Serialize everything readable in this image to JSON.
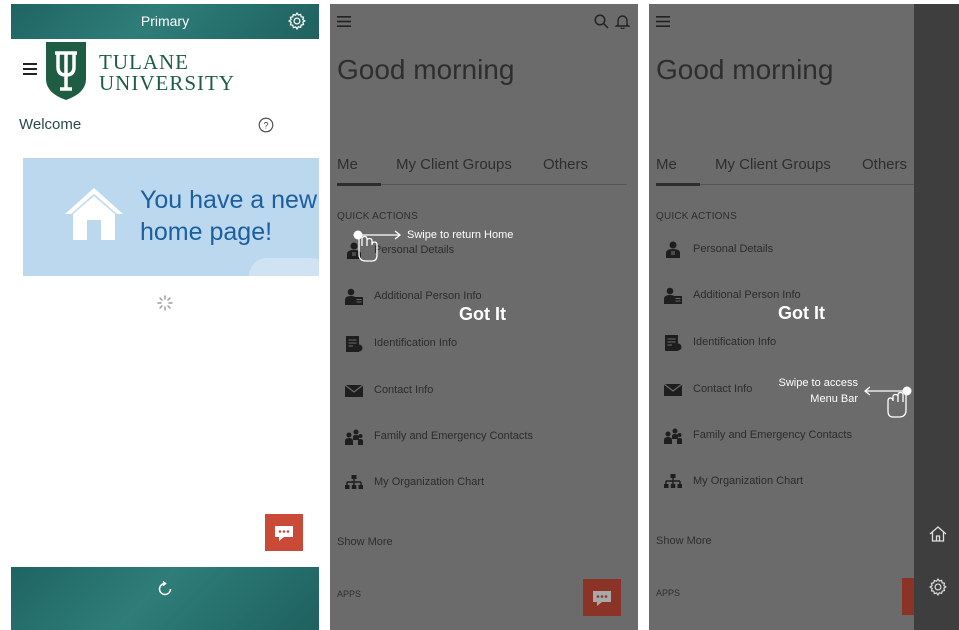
{
  "panel1": {
    "header_title": "Primary",
    "brand_line1": "TULANE",
    "brand_line2": "UNIVERSITY",
    "welcome": "Welcome",
    "banner_line1": "You have a new",
    "banner_line2": "home page!",
    "icons": [
      "settings-gear-icon",
      "menu-icon",
      "tulane-shield-logo",
      "help-icon",
      "home-icon",
      "loading-spinner-icon",
      "chat-icon",
      "refresh-icon"
    ]
  },
  "panel2": {
    "greeting": "Good morning",
    "tabs": [
      "Me",
      "My Client Groups",
      "Others"
    ],
    "quick_actions_heading": "QUICK ACTIONS",
    "quick_actions": [
      {
        "label": "Personal Details",
        "icon": "person-icon"
      },
      {
        "label": "Additional Person Info",
        "icon": "person-card-icon"
      },
      {
        "label": "Identification Info",
        "icon": "id-document-icon"
      },
      {
        "label": "Contact Info",
        "icon": "envelope-icon"
      },
      {
        "label": "Family and Emergency Contacts",
        "icon": "family-icon"
      },
      {
        "label": "My Organization Chart",
        "icon": "org-chart-icon"
      }
    ],
    "show_more": "Show More",
    "apps_heading": "APPS",
    "got_it": "Got It",
    "hint": "Swipe to return Home"
  },
  "panel3": {
    "greeting": "Good morning",
    "tabs": [
      "Me",
      "My Client Groups",
      "Others"
    ],
    "quick_actions_heading": "QUICK ACTIONS",
    "quick_actions": [
      {
        "label": "Personal Details"
      },
      {
        "label": "Additional Person Info"
      },
      {
        "label": "Identification Info"
      },
      {
        "label": "Contact Info"
      },
      {
        "label": "Family and Emergency Contacts"
      },
      {
        "label": "My Organization Chart"
      }
    ],
    "show_more": "Show More",
    "apps_heading": "APPS",
    "got_it": "Got It",
    "hint_line1": "Swipe to access",
    "hint_line2": "Menu Bar"
  },
  "colors": {
    "teal": "#26706d",
    "tulane_green": "#1e5d43",
    "banner_bg": "#bcd8ef",
    "banner_text": "#1b5f9e",
    "chat_red": "#c94a36",
    "overlay": "#6b6b6b"
  }
}
